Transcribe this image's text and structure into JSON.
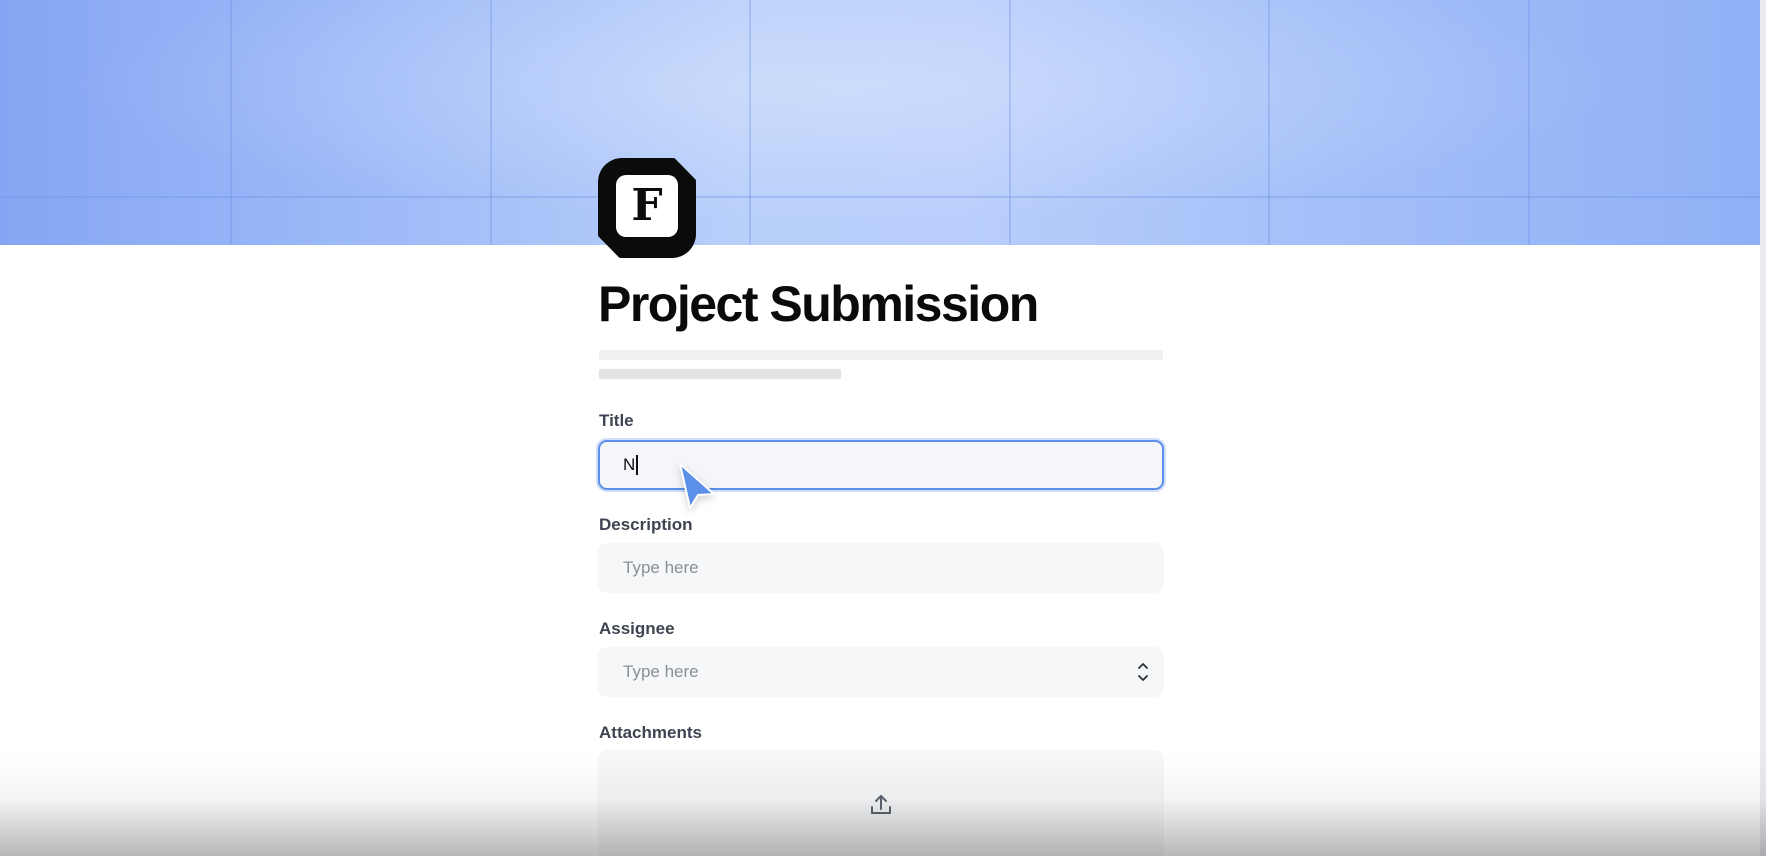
{
  "page": {
    "title": "Project Submission",
    "logo_letter": "F"
  },
  "colors": {
    "cover_gradient": [
      "#86a6f3",
      "#b8cffa",
      "#8fb0f6"
    ],
    "focus_border": "#5b8fe8",
    "cursor": "#5b8fe8",
    "label_text": "#3e4451",
    "field_background": "#f6f7f9"
  },
  "form": {
    "fields": [
      {
        "label": "Title",
        "value": "N",
        "placeholder": "Type here",
        "state": "focused"
      },
      {
        "label": "Description",
        "value": "",
        "placeholder": "Type here"
      },
      {
        "label": "Assignee",
        "value": "",
        "placeholder": "Type here",
        "control": "select"
      },
      {
        "label": "Attachments",
        "control": "file-upload"
      }
    ]
  },
  "icons": {
    "logo": "f-logo-icon",
    "select_chevrons": "chevron-up-down-icon",
    "upload": "upload-icon",
    "pointer": "mouse-pointer-icon"
  }
}
